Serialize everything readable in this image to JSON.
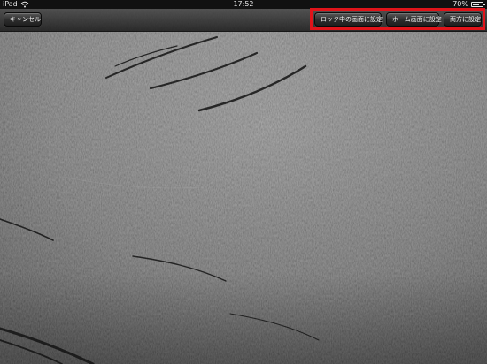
{
  "status_bar": {
    "device": "iPad",
    "wifi_icon": "wifi-icon",
    "time": "17:52",
    "battery": "70%",
    "battery_level": 0.7,
    "battery_icon": "battery-icon"
  },
  "toolbar": {
    "cancel_label": "キャンセル",
    "set_lock_screen_label": "ロック中の画面に設定",
    "set_home_screen_label": "ホーム画面に設定",
    "set_both_label": "両方に設定"
  },
  "colors": {
    "highlight": "#e0141a",
    "wallpaper_base": "#6b6b6b"
  }
}
